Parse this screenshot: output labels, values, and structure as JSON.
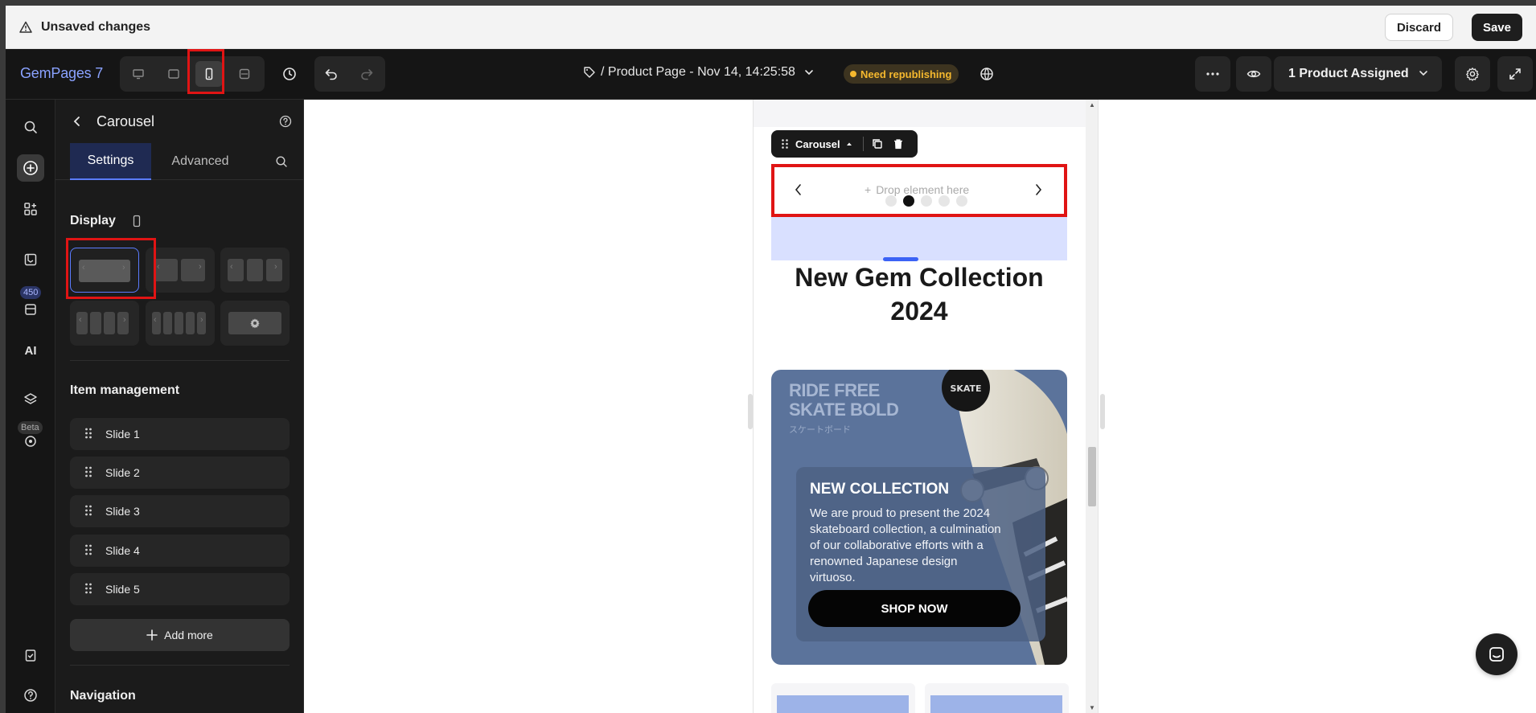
{
  "unsaved_bar": {
    "message": "Unsaved changes",
    "discard_label": "Discard",
    "save_label": "Save"
  },
  "toolbar": {
    "logo": "GemPages 7",
    "device_modes": [
      "desktop",
      "tablet",
      "mobile",
      "fullscreen"
    ],
    "active_device": "mobile",
    "page_title": "/ Product Page - Nov 14, 14:25:58",
    "status_badge": "Need republishing",
    "assigned_label": "1 Product Assigned"
  },
  "rail": {
    "badge_count": "450",
    "ai_label": "AI",
    "beta_label": "Beta"
  },
  "panel": {
    "title": "Carousel",
    "tabs": {
      "settings": "Settings",
      "advanced": "Advanced"
    },
    "display_label": "Display",
    "item_management_label": "Item management",
    "slides": [
      "Slide 1",
      "Slide 2",
      "Slide 3",
      "Slide 4",
      "Slide 5"
    ],
    "add_more_label": "Add more",
    "navigation_label": "Navigation"
  },
  "canvas": {
    "element_chip_label": "Carousel",
    "drop_placeholder": "Drop element here",
    "heading": "New Gem Collection 2024",
    "hero": {
      "brand_line1": "RIDE FREE",
      "brand_line2": "SKATE BOLD",
      "brand_sub": "スケートボード",
      "title": "NEW COLLECTION",
      "text": "We are proud to present the 2024 skateboard collection, a culmination of our collaborative efforts with a renowned Japanese design virtuoso.",
      "cta": "SHOP NOW"
    },
    "carousel_dots": 5,
    "active_dot": 1
  },
  "colors": {
    "accent": "#5b7cff",
    "highlight": "#e01414",
    "hero_bg": "#5b739b",
    "badge": "#f5b82e"
  }
}
